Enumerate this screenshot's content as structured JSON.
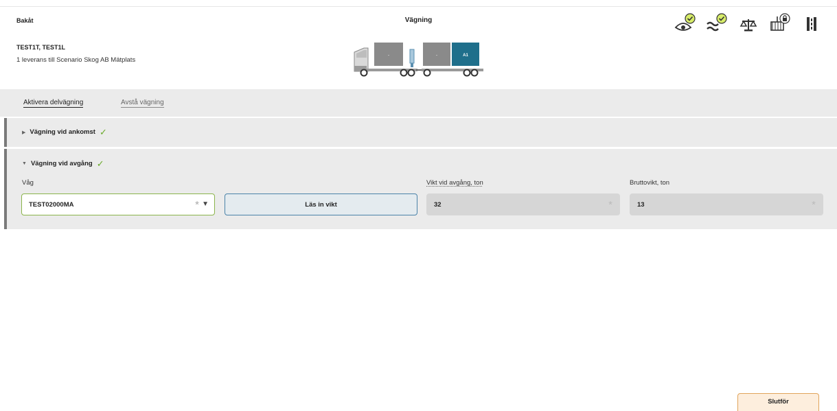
{
  "header": {
    "back_label": "Bakåt",
    "title": "Vägning",
    "vehicle_id": "TEST1T, TEST1L",
    "delivery_text": "1 leverans till Scenario Skog AB Mätplats"
  },
  "truck": {
    "load_labels": [
      "-",
      "-",
      "A1"
    ],
    "active_color": "#1f6f8b",
    "inactive_color": "#8a8a8a"
  },
  "status_icons": [
    {
      "name": "eye-icon",
      "badge": "check"
    },
    {
      "name": "waves-icon",
      "badge": "check"
    },
    {
      "name": "scale-icon",
      "badge": "none"
    },
    {
      "name": "crane-icon",
      "badge": "lock"
    },
    {
      "name": "road-icon",
      "badge": "none"
    }
  ],
  "actions": {
    "partial_weighing": "Aktivera delvägning",
    "skip_weighing": "Avstå vägning"
  },
  "sections": {
    "arrival": {
      "label": "Vägning vid ankomst",
      "checked": "✓"
    },
    "departure": {
      "label": "Vägning vid avgång",
      "checked": "✓"
    }
  },
  "fields": {
    "scale_label": "Våg",
    "scale_value": "TEST02000MA",
    "read_weight_button": "Läs in vikt",
    "departure_weight_label": "Vikt vid avgång, ton",
    "departure_weight_value": "32",
    "gross_weight_label": "Bruttovikt, ton",
    "gross_weight_value": "13",
    "required_marker": "*",
    "dropdown_glyph": "▼"
  },
  "footer": {
    "finish_button": "Slutför"
  },
  "colors": {
    "accent_green": "#6aaa2a",
    "button_blue_border": "#4a82a8",
    "finish_orange_border": "#e0a35a"
  }
}
